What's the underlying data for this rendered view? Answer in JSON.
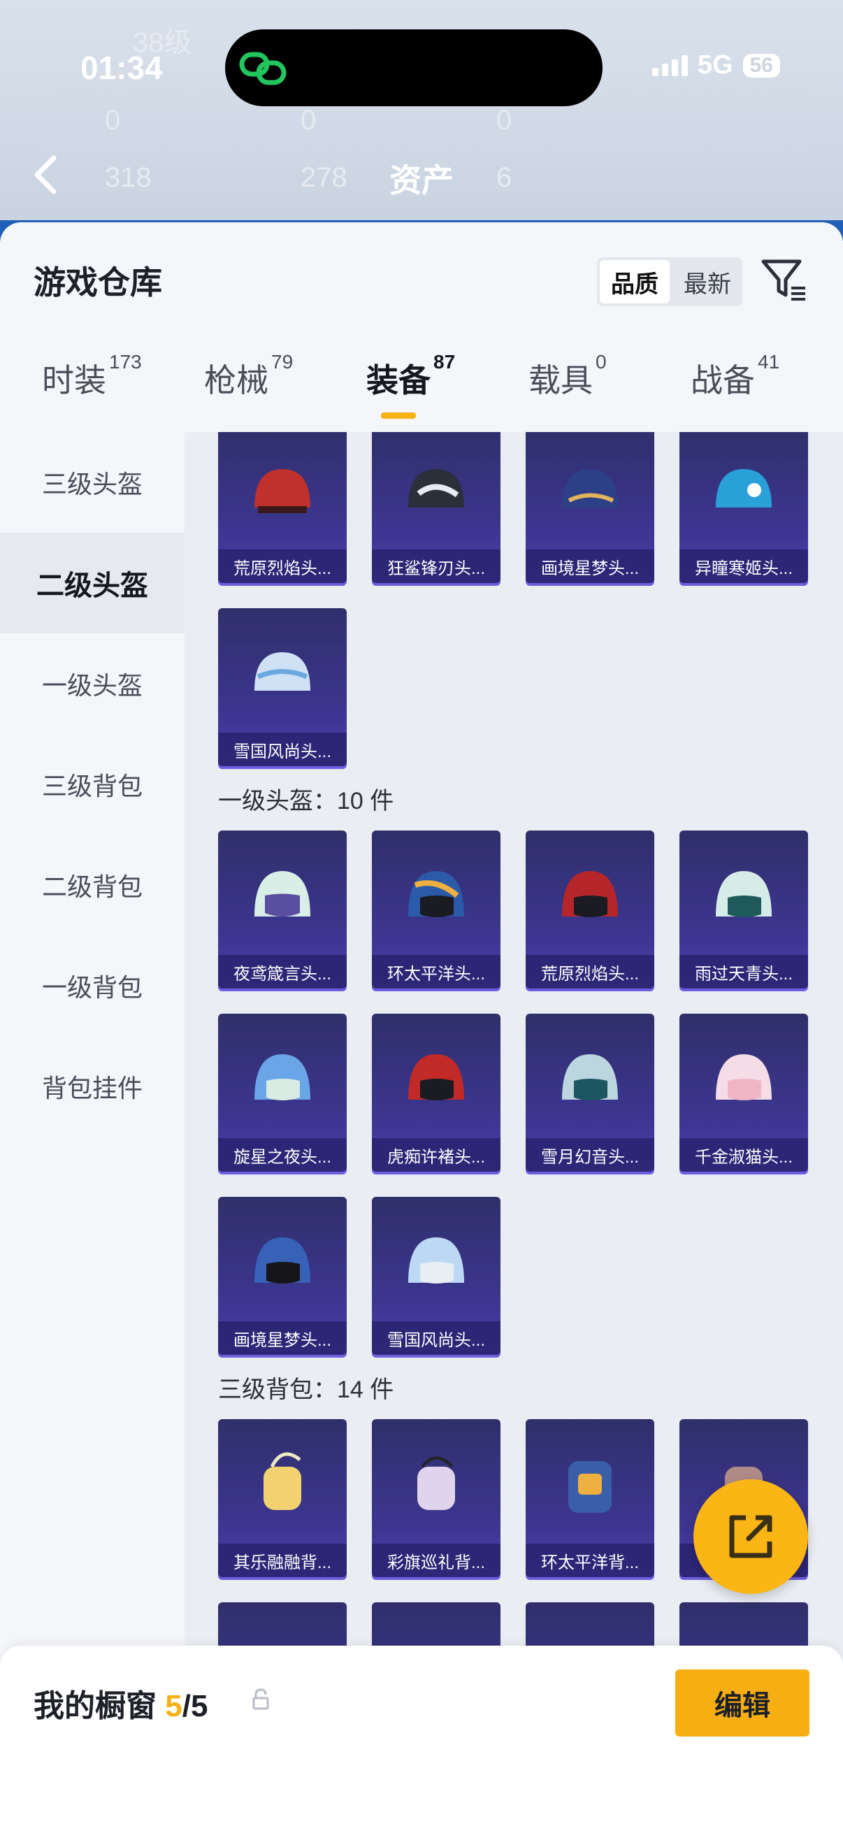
{
  "status": {
    "time": "01:34",
    "network": "5G",
    "battery": "56"
  },
  "header": {
    "title": "资产"
  },
  "ghost": {
    "level": "38级",
    "stat1": "0",
    "stat2": "0",
    "stat3": "0",
    "stat4": "318",
    "stat5": "278",
    "stat6": "6"
  },
  "sheet": {
    "title": "游戏仓库",
    "sort": [
      "品质",
      "最新"
    ]
  },
  "tabs": [
    {
      "label": "时装",
      "count": "173"
    },
    {
      "label": "枪械",
      "count": "79"
    },
    {
      "label": "装备",
      "count": "87"
    },
    {
      "label": "载具",
      "count": "0"
    },
    {
      "label": "战备",
      "count": "41"
    }
  ],
  "sidebar": [
    "三级头盔",
    "二级头盔",
    "一级头盔",
    "三级背包",
    "二级背包",
    "一级背包",
    "背包挂件"
  ],
  "sections": [
    {
      "label": "一级头盔：10 件"
    },
    {
      "label": "三级背包：14 件"
    }
  ],
  "cards_row1": [
    "荒原烈焰头...",
    "狂鲨锋刃头...",
    "画境星梦头...",
    "异瞳寒姬头..."
  ],
  "cards_row2": [
    "雪国风尚头..."
  ],
  "cards_row3": [
    "夜鸢箴言头...",
    "环太平洋头...",
    "荒原烈焰头...",
    "雨过天青头..."
  ],
  "cards_row4": [
    "旋星之夜头...",
    "虎痴许褚头...",
    "雪月幻音头...",
    "千金淑猫头..."
  ],
  "cards_row5": [
    "画境星梦头...",
    "雪国风尚头..."
  ],
  "cards_row6": [
    "其乐融融背...",
    "彩旗巡礼背...",
    "环太平洋背...",
    ""
  ],
  "footer": {
    "title": "我的橱窗",
    "used": "5",
    "sep": "/",
    "total": "5",
    "edit": "编辑"
  },
  "colors": {
    "accent": "#f5b212",
    "card": "#3d3693"
  }
}
